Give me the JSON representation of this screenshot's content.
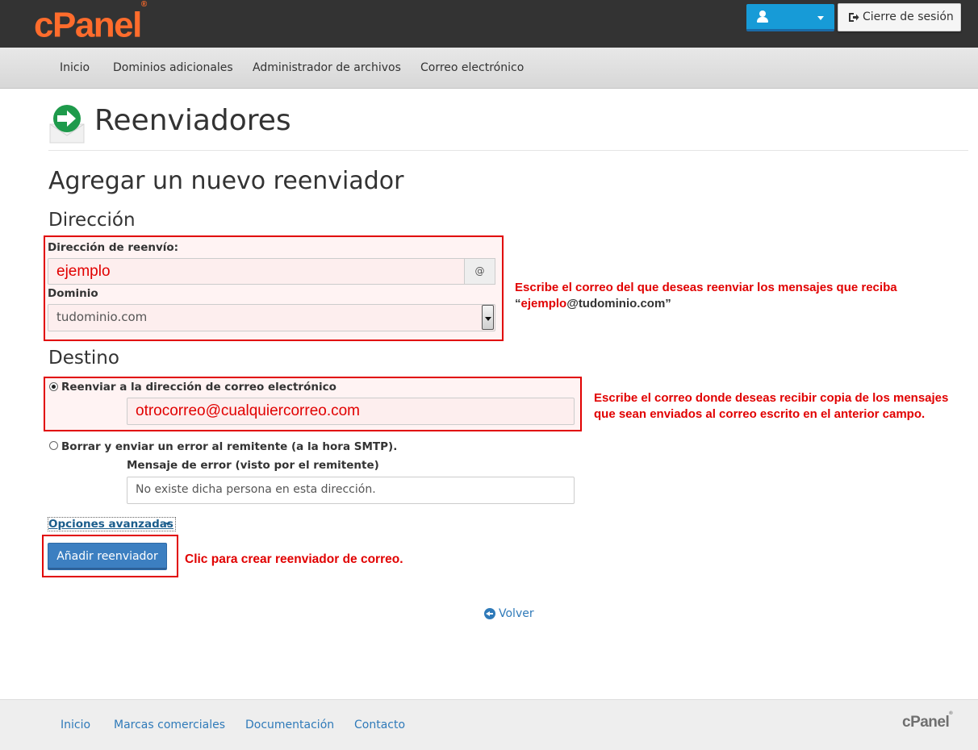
{
  "header": {
    "logo_text": "cPanel",
    "logo_mark": "®",
    "logout_label": "Cierre de sesión",
    "colors": {
      "topbar": "#333333",
      "logo": "#ff6c2c",
      "user_button": "#179bd7"
    }
  },
  "nav": {
    "items": [
      {
        "label": "Inicio"
      },
      {
        "label": "Dominios adicionales"
      },
      {
        "label": "Administrador de archivos"
      },
      {
        "label": "Correo electrónico"
      }
    ]
  },
  "page": {
    "title": "Reenviadores",
    "icon": "envelope-forward-icon",
    "subtitle": "Agregar un nuevo reenviador"
  },
  "address": {
    "heading": "Dirección",
    "forward_label": "Dirección de reenvío:",
    "forward_value": "ejemplo",
    "at_symbol": "@",
    "domain_label": "Dominio",
    "domain_value": "tudominio.com"
  },
  "destination": {
    "heading": "Destino",
    "option_forward_label": "Reenviar a la dirección de correo electrónico",
    "forward_email_value": "otrocorreo@cualquiercorreo.com",
    "option_discard_label": "Borrar y enviar un error al remitente (a la hora SMTP).",
    "error_message_label": "Mensaje de error (visto por el remitente)",
    "error_message_value": "No existe dicha persona en esta dirección."
  },
  "advanced_label": "Opciones avanzadas",
  "submit_label": "Añadir reenviador",
  "back_label": "Volver",
  "annotations": {
    "address_line1": "Escribe el correo del que deseas reenviar los mensajes que reciba",
    "address_line2_open": "“",
    "address_line2_red": "ejemplo",
    "address_line2_dark": "@tudominio.com”",
    "destination_line1": "Escribe el correo donde deseas recibir copia de los mensajes",
    "destination_line2": "que sean enviados al correo escrito en el anterior campo.",
    "button_note": "Clic para crear reenviador de correo."
  },
  "footer": {
    "links": [
      {
        "label": "Inicio"
      },
      {
        "label": "Marcas comerciales"
      },
      {
        "label": "Documentación"
      },
      {
        "label": "Contacto"
      }
    ],
    "logo_text": "cPanel",
    "logo_mark": "®"
  }
}
